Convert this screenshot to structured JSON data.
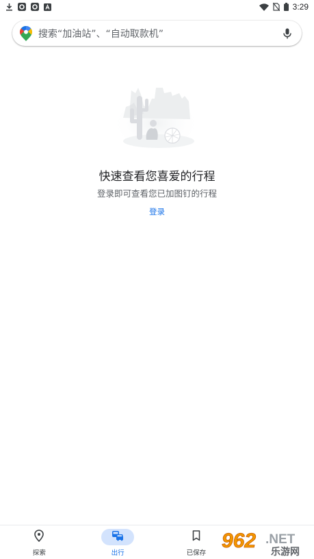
{
  "status_bar": {
    "time": "3:29",
    "left_icons": [
      "download-icon",
      "app-notification-icon",
      "app-notification-icon",
      "a-notification-icon"
    ],
    "right_icons": [
      "wifi-icon",
      "no-sim-icon",
      "battery-icon"
    ]
  },
  "search": {
    "placeholder": "搜索“加油站”、“自动取款机”",
    "left_icon": "google-maps-pin-icon",
    "right_icon": "mic-icon"
  },
  "empty_state": {
    "illustration": "desert-cactus-illustration",
    "title": "快速查看您喜爱的行程",
    "subtitle": "登录即可查看您已加图钉的行程",
    "sign_in_label": "登录"
  },
  "bottom_nav": {
    "items": [
      {
        "label": "探索",
        "icon": "location-pin-icon",
        "active": false
      },
      {
        "label": "出行",
        "icon": "commute-icon",
        "active": true
      },
      {
        "label": "已保存",
        "icon": "bookmark-icon",
        "active": false
      }
    ]
  },
  "watermark": {
    "number": "962",
    "suffix": ".NET",
    "caption": "乐游网"
  },
  "colors": {
    "accent": "#1a73e8",
    "active_pill": "#d3e3fd",
    "text_primary": "#202124",
    "text_secondary": "#5f6368"
  }
}
